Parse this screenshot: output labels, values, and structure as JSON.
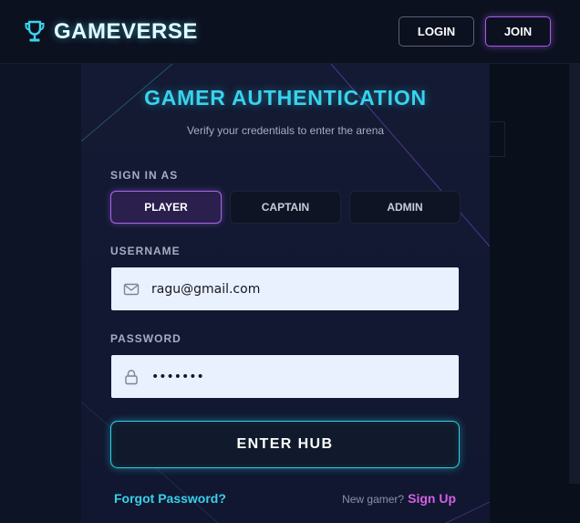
{
  "header": {
    "brand": "GAMEVERSE",
    "login_label": "LOGIN",
    "join_label": "JOIN"
  },
  "card": {
    "title": "GAMER AUTHENTICATION",
    "subtitle": "Verify your credentials to enter the arena",
    "role_label": "SIGN IN AS",
    "roles": [
      "PLAYER",
      "CAPTAIN",
      "ADMIN"
    ],
    "selected_role": "PLAYER",
    "username_label": "USERNAME",
    "username_value": "ragu@gmail.com",
    "password_label": "PASSWORD",
    "password_value": "•••••••",
    "submit_label": "ENTER HUB",
    "forgot_label": "Forgot Password?",
    "signup_prompt": "New gamer?",
    "signup_label": "Sign Up"
  },
  "icons": {
    "brand": "trophy-icon",
    "username": "mail-icon",
    "password": "lock-icon"
  },
  "colors": {
    "accent_cyan": "#37d4ee",
    "accent_purple": "#a866f0",
    "signup_pink": "#d25fe6",
    "background": "#0a0f1c",
    "card": "#141a33",
    "field": "#e9f0fe"
  }
}
